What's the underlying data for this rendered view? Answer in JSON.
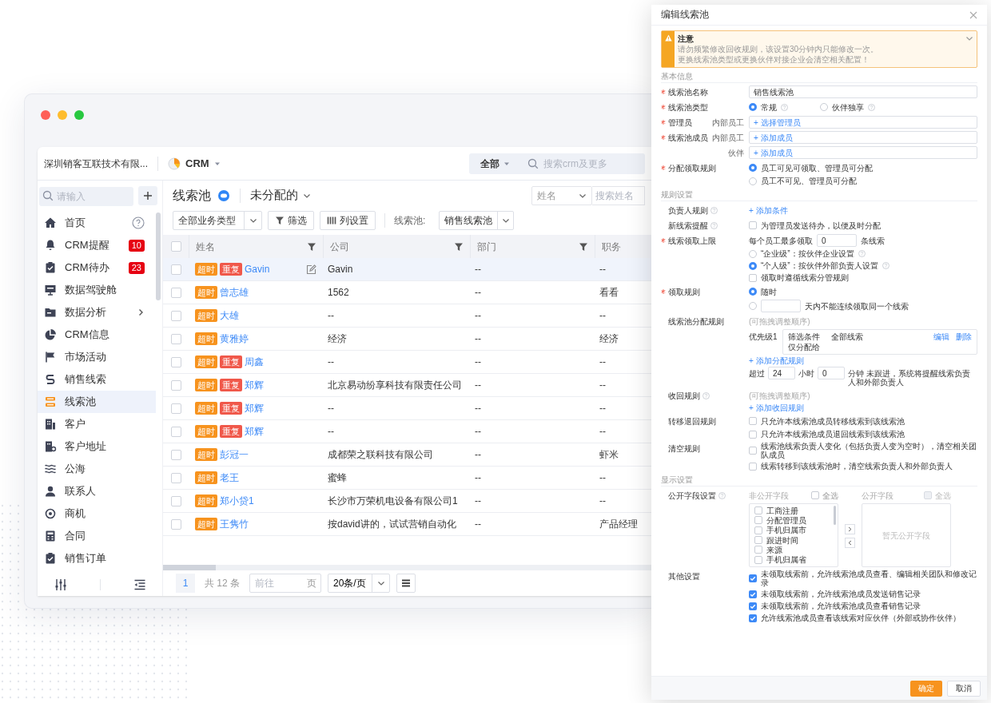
{
  "app_header": {
    "company": "深圳销客互联技术有限...",
    "app_name": "CRM",
    "scope": "全部",
    "search_placeholder": "搜索crm及更多"
  },
  "sidebar": {
    "search_placeholder": "请输入",
    "items": [
      {
        "label": "首页",
        "kind": "help",
        "selected": false
      },
      {
        "label": "CRM提醒",
        "kind": "badge",
        "badge": "10",
        "selected": false
      },
      {
        "label": "CRM待办",
        "kind": "badge",
        "badge": "23",
        "selected": false
      },
      {
        "label": "数据驾驶舱",
        "kind": "link",
        "selected": false
      },
      {
        "label": "数据分析",
        "kind": "submenu",
        "selected": false
      },
      {
        "label": "CRM信息",
        "kind": "link",
        "selected": false
      },
      {
        "label": "市场活动",
        "kind": "link",
        "selected": false
      },
      {
        "label": "销售线索",
        "kind": "link",
        "selected": false
      },
      {
        "label": "线索池",
        "kind": "link",
        "selected": true
      },
      {
        "label": "客户",
        "kind": "link",
        "selected": false
      },
      {
        "label": "客户地址",
        "kind": "link",
        "selected": false
      },
      {
        "label": "公海",
        "kind": "link",
        "selected": false
      },
      {
        "label": "联系人",
        "kind": "link",
        "selected": false
      },
      {
        "label": "商机",
        "kind": "link",
        "selected": false
      },
      {
        "label": "合同",
        "kind": "link",
        "selected": false
      },
      {
        "label": "销售订单",
        "kind": "link",
        "selected": false
      }
    ]
  },
  "list_header": {
    "title": "线索池",
    "view": "未分配的",
    "field": "姓名",
    "search_placeholder": "搜索姓名"
  },
  "toolbar": {
    "business_type": "全部业务类型",
    "filter": "筛选",
    "columns": "列设置",
    "pool_label": "线索池:",
    "pool": "销售线索池"
  },
  "table": {
    "all_checked": false,
    "columns": [
      {
        "label": "姓名",
        "filter": true
      },
      {
        "label": "公司",
        "filter": true
      },
      {
        "label": "部门",
        "filter": true
      },
      {
        "label": "职务",
        "filter": false
      }
    ],
    "rows": [
      {
        "checked": false,
        "hovered": true,
        "tags": [
          {
            "label": "超时",
            "kind": "timeout"
          },
          {
            "label": "重复",
            "kind": "duplicate"
          }
        ],
        "name": "Gavin",
        "company": "Gavin",
        "department": "--",
        "position": "--"
      },
      {
        "checked": false,
        "hovered": false,
        "tags": [
          {
            "label": "超时",
            "kind": "timeout"
          }
        ],
        "name": "曾志雄",
        "company": "1562",
        "department": "--",
        "position": "看看"
      },
      {
        "checked": false,
        "hovered": false,
        "tags": [
          {
            "label": "超时",
            "kind": "timeout"
          }
        ],
        "name": "大雄",
        "company": "--",
        "department": "--",
        "position": "--"
      },
      {
        "checked": false,
        "hovered": false,
        "tags": [
          {
            "label": "超时",
            "kind": "timeout"
          }
        ],
        "name": "黄雅婷",
        "company": "经济",
        "department": "--",
        "position": "经济"
      },
      {
        "checked": false,
        "hovered": false,
        "tags": [
          {
            "label": "超时",
            "kind": "timeout"
          },
          {
            "label": "重复",
            "kind": "duplicate"
          }
        ],
        "name": "周鑫",
        "company": "--",
        "department": "--",
        "position": "--"
      },
      {
        "checked": false,
        "hovered": false,
        "tags": [
          {
            "label": "超时",
            "kind": "timeout"
          },
          {
            "label": "重复",
            "kind": "duplicate"
          }
        ],
        "name": "郑辉",
        "company": "北京易动纷享科技有限责任公司",
        "department": "--",
        "position": "--"
      },
      {
        "checked": false,
        "hovered": false,
        "tags": [
          {
            "label": "超时",
            "kind": "timeout"
          },
          {
            "label": "重复",
            "kind": "duplicate"
          }
        ],
        "name": "郑辉",
        "company": "--",
        "department": "--",
        "position": "--"
      },
      {
        "checked": false,
        "hovered": false,
        "tags": [
          {
            "label": "超时",
            "kind": "timeout"
          },
          {
            "label": "重复",
            "kind": "duplicate"
          }
        ],
        "name": "郑辉",
        "company": "--",
        "department": "--",
        "position": "--"
      },
      {
        "checked": false,
        "hovered": false,
        "tags": [
          {
            "label": "超时",
            "kind": "timeout"
          }
        ],
        "name": "彭冠一",
        "company": "成都荣之联科技有限公司",
        "department": "--",
        "position": "虾米"
      },
      {
        "checked": false,
        "hovered": false,
        "tags": [
          {
            "label": "超时",
            "kind": "timeout"
          }
        ],
        "name": "老王",
        "company": "蜜蜂",
        "department": "--",
        "position": "--"
      },
      {
        "checked": false,
        "hovered": false,
        "tags": [
          {
            "label": "超时",
            "kind": "timeout"
          }
        ],
        "name": "郑小贷1",
        "company": "长沙市万荣机电设备有限公司1",
        "department": "--",
        "position": "--"
      },
      {
        "checked": false,
        "hovered": false,
        "tags": [
          {
            "label": "超时",
            "kind": "timeout"
          }
        ],
        "name": "王隽竹",
        "company": "按david讲的，试试营销自动化",
        "department": "--",
        "position": "产品经理"
      }
    ]
  },
  "pagination": {
    "page": "1",
    "total": "共 12 条",
    "goto_placeholder": "前往",
    "page_unit": "页",
    "page_size": "20条/页"
  },
  "dialog": {
    "title": "编辑线索池",
    "notice": {
      "title": "注意",
      "lines": [
        "请勿频繁修改回收规则，该设置30分钟内只能修改一次。",
        "更换线索池类型或更换伙伴对接企业会清空相关配置！"
      ]
    },
    "sections": [
      {
        "heading": "基本信息",
        "fields": [
          {
            "kind": "input",
            "label": "线索池名称",
            "required": true,
            "help": false,
            "value": "销售线索池"
          },
          {
            "kind": "radio_inline",
            "label": "线索池类型",
            "required": true,
            "help": false,
            "options": [
              {
                "label": "常规",
                "selected": true,
                "help": true
              },
              {
                "label": "伙伴独享",
                "selected": false,
                "help": true
              }
            ]
          },
          {
            "kind": "picker",
            "label": "管理员",
            "required": true,
            "help": false,
            "entries": [
              {
                "sublabel": "内部员工",
                "action": "+ 选择管理员"
              }
            ]
          },
          {
            "kind": "picker",
            "label": "线索池成员",
            "required": true,
            "help": false,
            "entries": [
              {
                "sublabel": "内部员工",
                "action": "+ 添加成员"
              },
              {
                "sublabel": "伙伴",
                "action": "+ 添加成员"
              }
            ]
          },
          {
            "kind": "radio",
            "label": "分配领取规则",
            "required": true,
            "help": false,
            "options": [
              {
                "label": "员工可见可领取、管理员可分配",
                "selected": true
              },
              {
                "label": "员工不可见、管理员可分配",
                "selected": false
              }
            ]
          }
        ]
      },
      {
        "heading": "规则设置",
        "fields": [
          {
            "kind": "link",
            "label": "负责人规则",
            "required": false,
            "help": true,
            "action": "+ 添加条件"
          },
          {
            "kind": "checks",
            "label": "新线索提醒",
            "required": false,
            "help": true,
            "options": [
              {
                "label": "为管理员发送待办，以便及时分配",
                "checked": false
              }
            ]
          },
          {
            "kind": "limit",
            "label": "线索领取上限",
            "required": true,
            "help": false,
            "prefix": "每个员工最多领取",
            "value": "0",
            "suffix": "条线索",
            "options": [
              {
                "kind": "radio",
                "label": "“企业级”：按伙伴企业设置",
                "selected": false,
                "help": true
              },
              {
                "kind": "radio",
                "label": "“个人级”：按伙伴外部负责人设置",
                "selected": true,
                "help": true
              },
              {
                "kind": "checkbox",
                "label": "领取时遵循线索分管规则",
                "checked": false,
                "help": false
              }
            ]
          },
          {
            "kind": "radio",
            "label": "领取规则",
            "required": true,
            "help": false,
            "options": [
              {
                "label": "随时",
                "selected": true,
                "input_before": false
              },
              {
                "label": "天内不能连续领取同一个线索",
                "selected": false,
                "input_before": true
              }
            ]
          },
          {
            "kind": "assign",
            "label": "线索池分配规则",
            "required": false,
            "help": false,
            "hint": "(可拖拽调整顺序)",
            "rules": [
              {
                "priority": "优先级1",
                "condition_label": "筛选条件",
                "condition": "全部线索",
                "method": "仅分配给",
                "edit": "编辑",
                "delete": "删除"
              }
            ],
            "action": "+ 添加分配规则",
            "timeout": {
              "prefix": "超过",
              "hours": "24",
              "hours_unit": "小时",
              "minutes": "0",
              "tail": "分钟 未跟进，系统将提醒线索负责人和外部负责人"
            }
          },
          {
            "kind": "hint_link",
            "label": "收回规则",
            "required": false,
            "help": true,
            "hint": "(可拖拽调整顺序)",
            "action": "+ 添加收回规则"
          },
          {
            "kind": "checks",
            "label": "转移退回规则",
            "required": false,
            "help": false,
            "options": [
              {
                "label": "只允许本线索池成员转移线索到该线索池",
                "checked": false
              },
              {
                "label": "只允许本线索池成员退回线索到该线索池",
                "checked": false
              }
            ]
          },
          {
            "kind": "checks",
            "label": "清空规则",
            "required": false,
            "help": false,
            "options": [
              {
                "label": "线索池线索负责人变化（包括负责人变为空时），清空相关团队成员",
                "checked": false
              },
              {
                "label": "线索转移到该线索池时，清空线索负责人和外部负责人",
                "checked": false
              }
            ]
          }
        ]
      },
      {
        "heading": "显示设置",
        "fields": [
          {
            "kind": "transfer",
            "label": "公开字段设置",
            "required": false,
            "help": true,
            "left": {
              "title": "非公开字段",
              "select_all": "全选",
              "all_checked": false,
              "items": [
                {
                  "label": "工商注册",
                  "checked": false
                },
                {
                  "label": "分配管理员",
                  "checked": false
                },
                {
                  "label": "手机归属市",
                  "checked": false
                },
                {
                  "label": "跟进时间",
                  "checked": false
                },
                {
                  "label": "来源",
                  "checked": false
                },
                {
                  "label": "手机归属省",
                  "checked": false
                }
              ]
            },
            "right": {
              "title": "公开字段",
              "select_all": "全选",
              "disabled": true,
              "empty": "暂无公开字段"
            }
          },
          {
            "kind": "checks",
            "label": "其他设置",
            "required": false,
            "help": false,
            "options": [
              {
                "label": "未领取线索前，允许线索池成员查看、编辑相关团队和修改记录",
                "checked": true
              },
              {
                "label": "未领取线索前，允许线索池成员发送销售记录",
                "checked": true
              },
              {
                "label": "未领取线索前，允许线索池成员查看销售记录",
                "checked": true
              },
              {
                "label": "允许线索池成员查看该线索对应伙伴（外部或协作伙伴）",
                "checked": true
              }
            ]
          }
        ]
      }
    ],
    "buttons": [
      {
        "label": "确定",
        "primary": true
      },
      {
        "label": "取消",
        "primary": false
      }
    ]
  }
}
